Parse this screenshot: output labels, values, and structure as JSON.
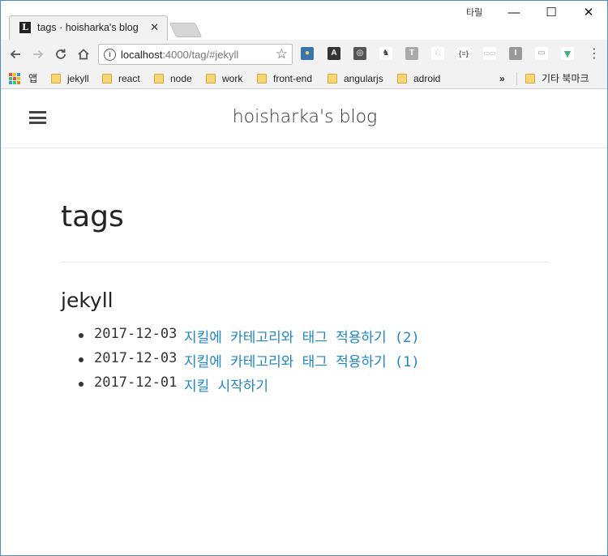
{
  "browser": {
    "tab": {
      "favicon": "L",
      "title": "tags · hoisharka's blog",
      "close": "✕"
    },
    "ime_indicator": "타릴",
    "window_controls": {
      "minimize": "—",
      "maximize": "☐",
      "close": "✕"
    },
    "url": {
      "host": "localhost",
      "path": ":4000/tag/#jekyll"
    },
    "extensions": [
      "python-icon",
      "translate-icon",
      "bulb-icon",
      "evernote-icon",
      "t-icon",
      "bunny-icon",
      "json-icon",
      "grid-icon",
      "i-icon",
      "cast-icon",
      "vue-icon"
    ],
    "bookmarks": {
      "apps_label": "앱",
      "items": [
        {
          "label": "jekyll"
        },
        {
          "label": "react"
        },
        {
          "label": "node"
        },
        {
          "label": "work"
        },
        {
          "label": "front-end"
        },
        {
          "label": "angularjs"
        },
        {
          "label": "adroid"
        }
      ],
      "overflow": "»",
      "other_label": "기타 북마크"
    }
  },
  "site": {
    "title": "hoisharka's blog"
  },
  "main": {
    "page_title": "tags",
    "tag": "jekyll",
    "posts": [
      {
        "date": "2017-12-03",
        "title": "지킬에 카테고리와 태그 적용하기 (2)"
      },
      {
        "date": "2017-12-03",
        "title": "지킬에 카테고리와 태그 적용하기 (1)"
      },
      {
        "date": "2017-12-01",
        "title": "지킬 시작하기"
      }
    ]
  },
  "colors": {
    "link": "#1f86c8",
    "text": "#222222",
    "window_border": "#4a90c8"
  }
}
